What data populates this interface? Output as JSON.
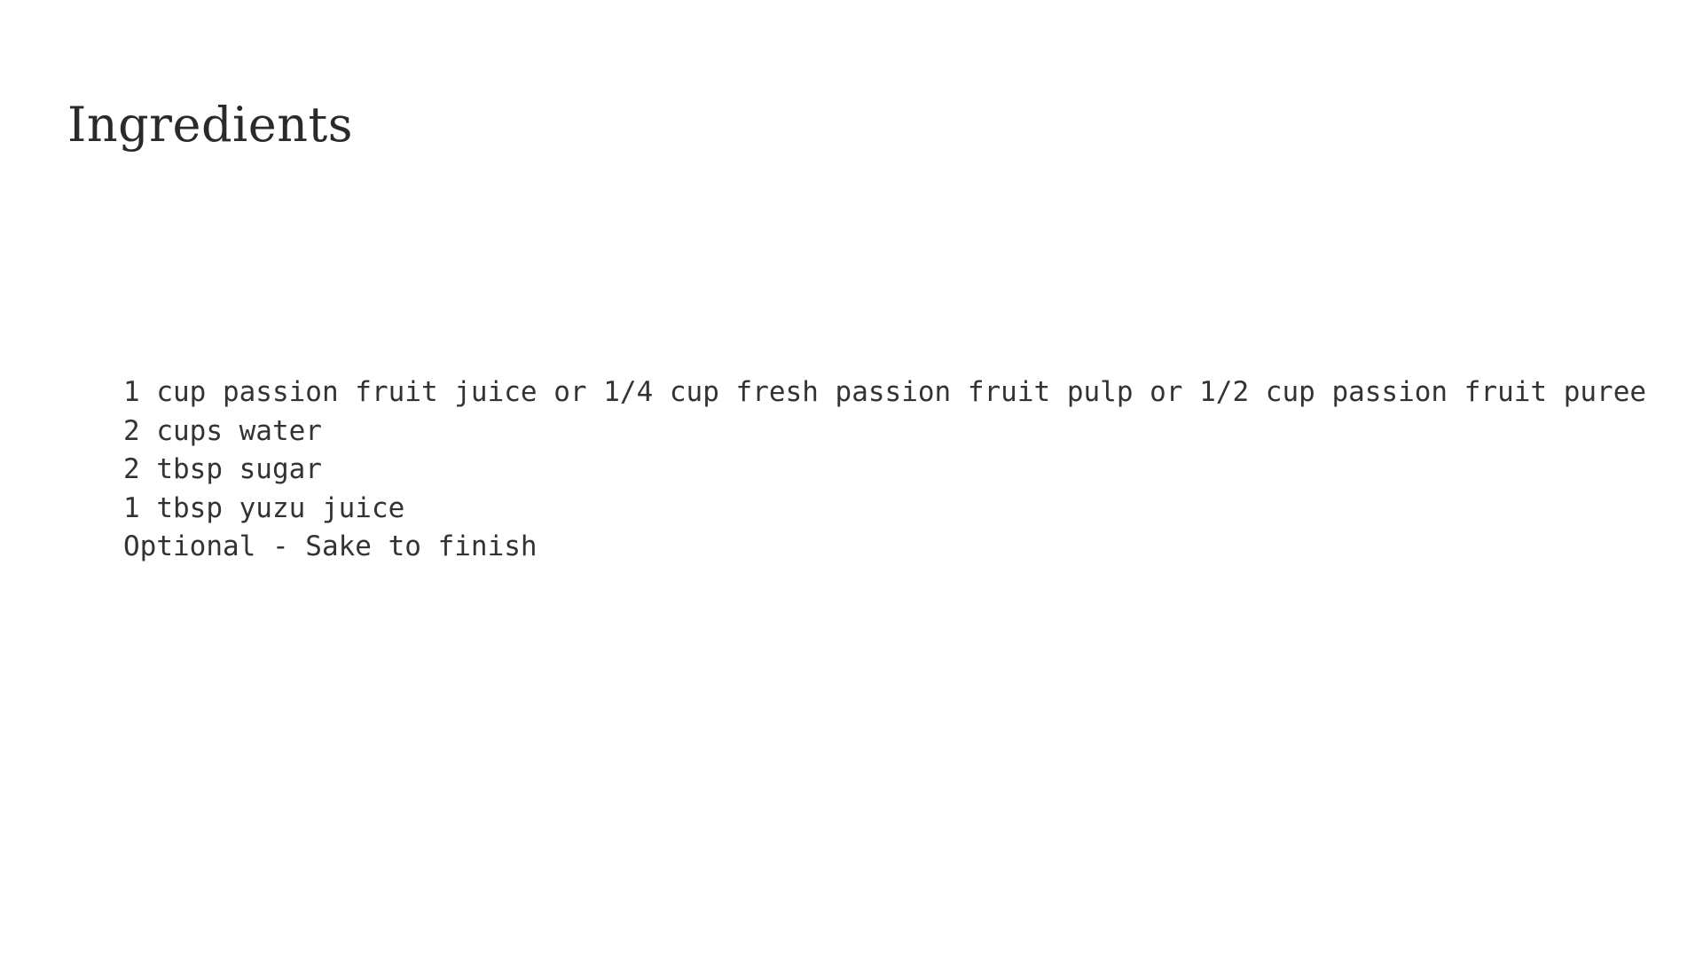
{
  "slide": {
    "title": "Ingredients",
    "items": [
      "1 cup passion fruit juice or 1/4 cup fresh passion fruit pulp or 1/2 cup passion fruit puree",
      "2 cups water",
      "2 tbsp sugar",
      "1 tbsp yuzu juice",
      "Optional - Sake to finish"
    ]
  }
}
